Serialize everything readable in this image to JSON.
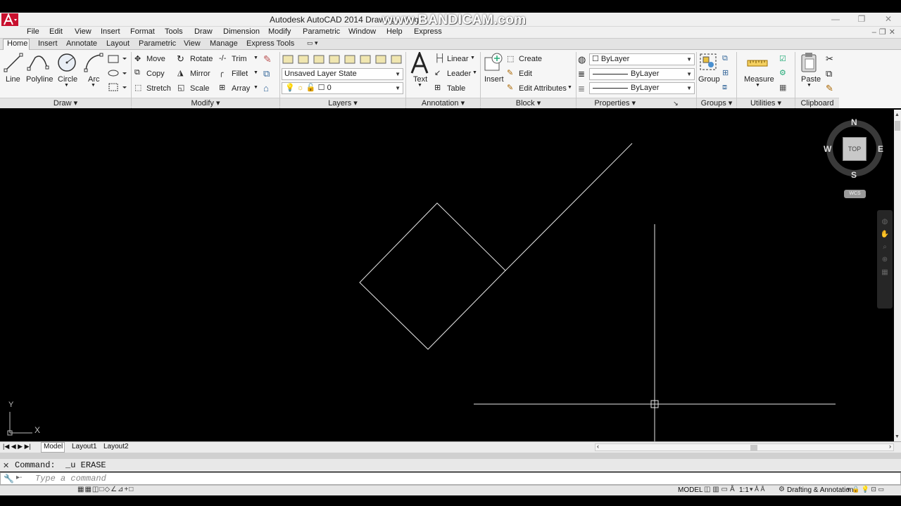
{
  "window": {
    "title": "Autodesk AutoCAD 2014   Drawing1.dwg",
    "watermark": "www.BANDICAM.com",
    "controls": [
      "—",
      "❐",
      "✕"
    ]
  },
  "menu": [
    "File",
    "Edit",
    "View",
    "Insert",
    "Format",
    "Tools",
    "Draw",
    "Dimension",
    "Modify",
    "Parametric",
    "Window",
    "Help",
    "Express"
  ],
  "ribbon_tabs": [
    "Home",
    "Insert",
    "Annotate",
    "Layout",
    "Parametric",
    "View",
    "Manage",
    "Express Tools"
  ],
  "active_tab": "Home",
  "panels": {
    "draw": {
      "title": "Draw",
      "tools": [
        "Line",
        "Polyline",
        "Circle",
        "Arc"
      ]
    },
    "modify": {
      "title": "Modify",
      "tools": [
        "Move",
        "Rotate",
        "Trim",
        "Copy",
        "Mirror",
        "Fillet",
        "Stretch",
        "Scale",
        "Array"
      ]
    },
    "layers": {
      "title": "Layers",
      "layer_state": "Unsaved Layer State",
      "current_layer": "0"
    },
    "annotation": {
      "title": "Annotation",
      "tools": [
        "Text",
        "Linear",
        "Leader",
        "Table"
      ]
    },
    "block": {
      "title": "Block",
      "tools": [
        "Insert",
        "Create",
        "Edit",
        "Edit Attributes"
      ]
    },
    "properties": {
      "title": "Properties",
      "color": "ByLayer",
      "linetype": "ByLayer",
      "lineweight": "ByLayer"
    },
    "groups": {
      "title": "Groups",
      "tool": "Group"
    },
    "utilities": {
      "title": "Utilities",
      "tool": "Measure"
    },
    "clipboard": {
      "title": "Clipboard",
      "tool": "Paste"
    }
  },
  "viewcube": {
    "n": "N",
    "s": "S",
    "e": "E",
    "w": "W",
    "face": "TOP",
    "wcs": "WCS"
  },
  "ucs": {
    "y": "Y",
    "x": "X"
  },
  "layout_tabs": [
    "Model",
    "Layout1",
    "Layout2"
  ],
  "command_history": "Command:  _u ERASE",
  "command_placeholder": "Type a command",
  "status": {
    "model": "MODEL",
    "scale": "1:1",
    "workspace": "Drafting & Annotation"
  },
  "colors": {
    "canvas": "#000000",
    "geometry": "#e8e8e8",
    "ribbon": "#f6f6f6",
    "accent": "#c8102e"
  }
}
